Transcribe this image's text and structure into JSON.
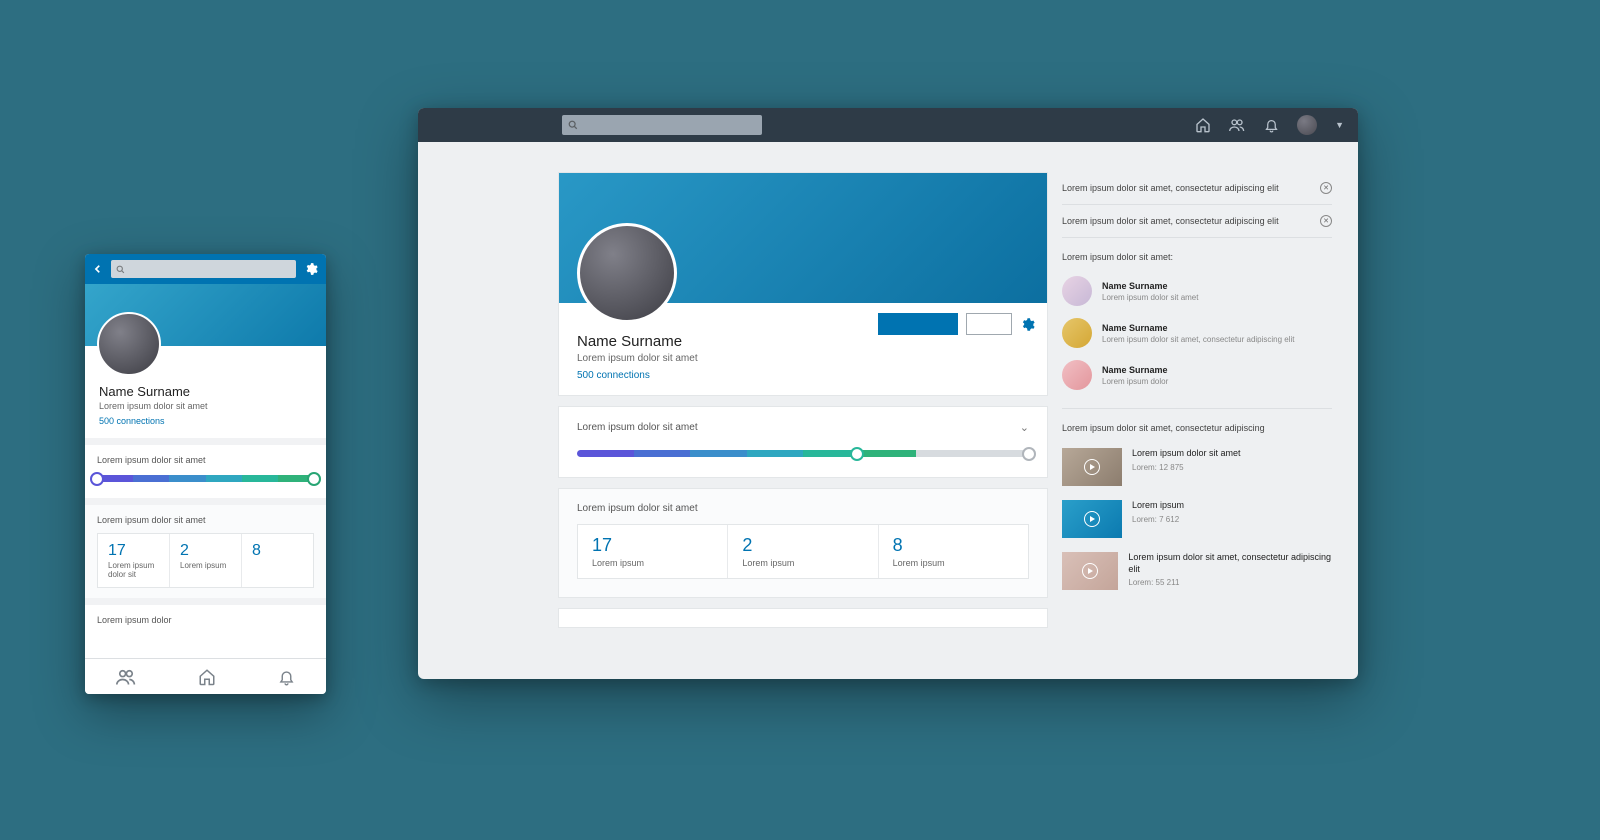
{
  "desktop": {
    "topbar": {
      "search_placeholder": ""
    },
    "profile": {
      "name": "Name Surname",
      "subtitle": "Lorem ipsum dolor sit amet",
      "connections": "500 connections"
    },
    "progress": {
      "label": "Lorem ipsum dolor sit amet",
      "segments": [
        "#5b55d9",
        "#4a6fd3",
        "#3b8ecb",
        "#2fa7c0",
        "#28b79a",
        "#2fb27a",
        "#d7dbdf",
        "#d7dbdf"
      ],
      "knob_pct": 62,
      "end_knob_pct": 100
    },
    "stats": {
      "label": "Lorem ipsum dolor sit amet",
      "items": [
        {
          "value": "17",
          "label": "Lorem ipsum"
        },
        {
          "value": "2",
          "label": "Lorem ipsum"
        },
        {
          "value": "8",
          "label": "Lorem ipsum"
        }
      ]
    }
  },
  "sidebar": {
    "notices": [
      "Lorem ipsum dolor sit amet, consectetur adipiscing elit",
      "Lorem ipsum dolor sit amet, consectetur adipiscing elit"
    ],
    "people_heading": "Lorem ipsum dolor sit amet:",
    "people": [
      {
        "name": "Name Surname",
        "desc": "Lorem ipsum dolor sit amet",
        "color": "linear-gradient(135deg,#e8d3e4,#c7b8d6)"
      },
      {
        "name": "Name Surname",
        "desc": "Lorem ipsum dolor sit amet, consectetur adipiscing elit",
        "color": "linear-gradient(135deg,#e6c66a,#d4a735)"
      },
      {
        "name": "Name Surname",
        "desc": "Lorem ipsum dolor",
        "color": "linear-gradient(135deg,#f1bfc4,#e3969c)"
      }
    ],
    "videos_heading": "Lorem ipsum dolor sit amet, consectetur adipiscing",
    "videos": [
      {
        "title": "Lorem ipsum dolor sit amet",
        "count": "Lorem: 12 875",
        "bg": "linear-gradient(135deg,#b7a898,#8c7d6e)"
      },
      {
        "title": "Lorem ipsum",
        "count": "Lorem: 7 612",
        "bg": "linear-gradient(135deg,#2a9fca,#0b7ab0)"
      },
      {
        "title": "Lorem ipsum dolor sit amet, consectetur adipiscing elit",
        "count": "Lorem: 55 211",
        "bg": "linear-gradient(135deg,#d9c0b8,#c4a59a)"
      }
    ]
  },
  "mobile": {
    "profile": {
      "name": "Name Surname",
      "subtitle": "Lorem ipsum dolor sit amet",
      "connections": "500 connections"
    },
    "progress": {
      "label": "Lorem ipsum dolor sit amet",
      "segments": [
        "#5b55d9",
        "#4a6fd3",
        "#3b8ecb",
        "#2fa7c0",
        "#28b79a",
        "#2fb27a"
      ],
      "knob_pct": 100
    },
    "stats": {
      "label": "Lorem ipsum dolor sit amet",
      "items": [
        {
          "value": "17",
          "label": "Lorem ipsum dolor sit"
        },
        {
          "value": "2",
          "label": "Lorem ipsum"
        },
        {
          "value": "8",
          "label": ""
        }
      ]
    },
    "extra_label": "Lorem ipsum dolor"
  }
}
